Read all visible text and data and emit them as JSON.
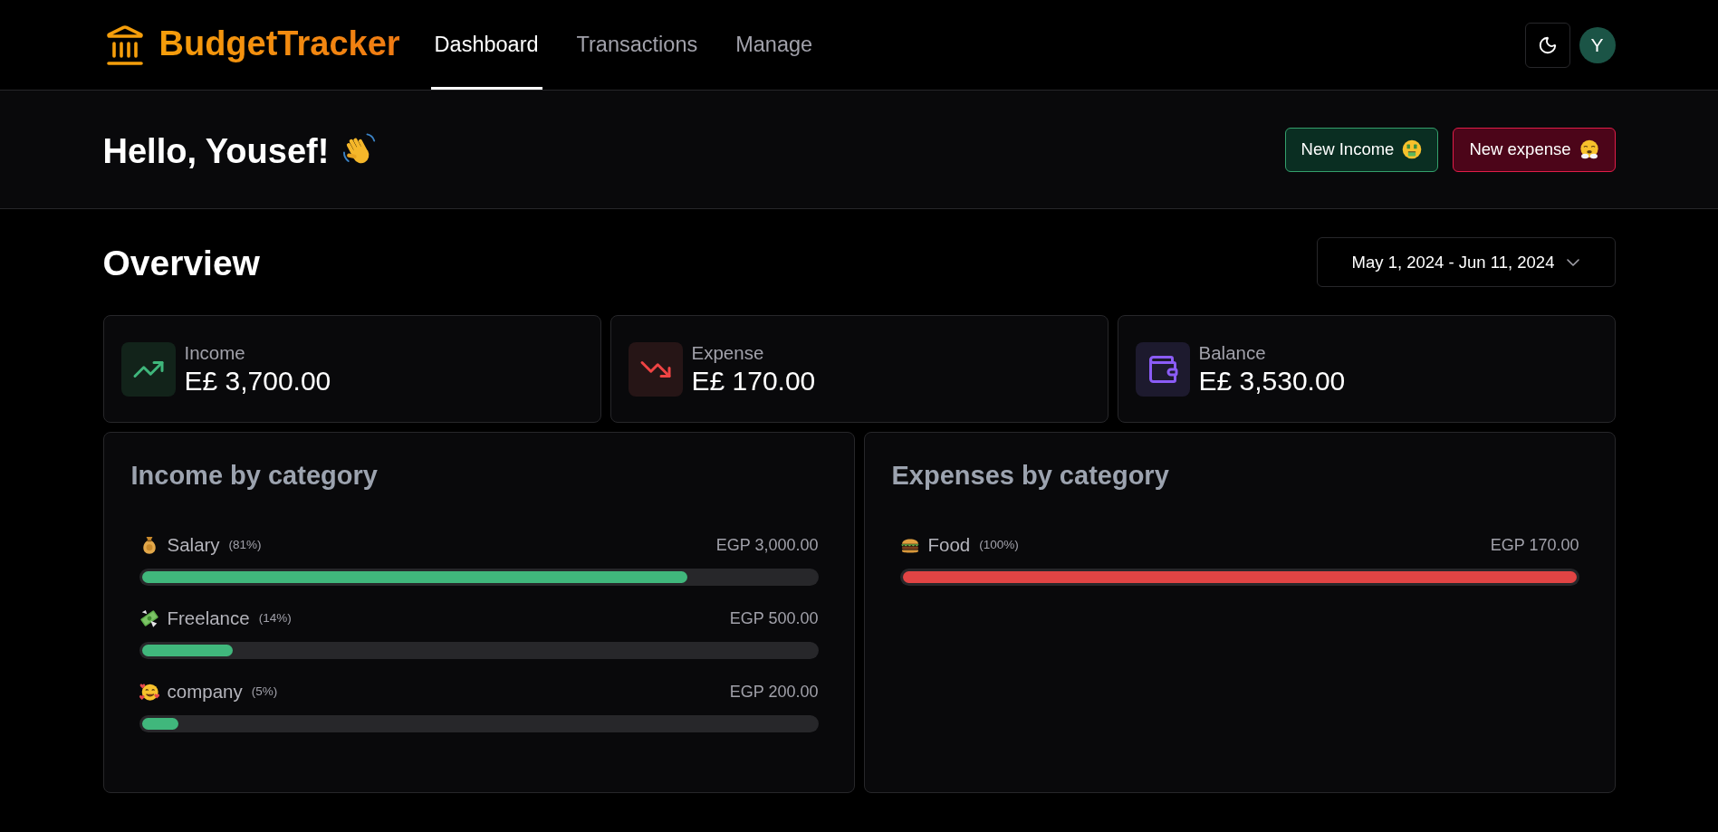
{
  "header": {
    "logo": "BudgetTracker",
    "nav": [
      {
        "label": "Dashboard",
        "selected": true
      },
      {
        "label": "Transactions",
        "selected": false
      },
      {
        "label": "Manage",
        "selected": false
      }
    ],
    "avatar": "Y"
  },
  "greeting": {
    "title": "Hello, Yousef!",
    "buttons": [
      {
        "kind": "income",
        "label": "New Income"
      },
      {
        "kind": "expense",
        "label": "New expense"
      }
    ]
  },
  "overview": {
    "title": "Overview",
    "date_range": "May 1, 2024 - Jun 11, 2024",
    "stats": [
      {
        "kind": "income",
        "label": "Income",
        "value": "E£ 3,700.00"
      },
      {
        "kind": "expense",
        "label": "Expense",
        "value": "E£ 170.00"
      },
      {
        "kind": "balance",
        "label": "Balance",
        "value": "E£ 3,530.00"
      }
    ]
  },
  "categories": [
    {
      "kind": "income",
      "title": "Income by category",
      "items": [
        {
          "kind": "bag",
          "name": "Salary",
          "percent": "(81%)",
          "amount": "EGP 3,000.00",
          "level": 0.81
        },
        {
          "kind": "cash",
          "name": "Freelance",
          "percent": "(14%)",
          "amount": "EGP 500.00",
          "level": 0.135
        },
        {
          "kind": "hearts",
          "name": "company",
          "percent": "(5%)",
          "amount": "EGP 200.00",
          "level": 0.054
        }
      ]
    },
    {
      "kind": "expense",
      "title": "Expenses by category",
      "items": [
        {
          "kind": "burger",
          "name": "Food",
          "percent": "(100%)",
          "amount": "EGP 170.00",
          "level": 1
        }
      ]
    }
  ]
}
